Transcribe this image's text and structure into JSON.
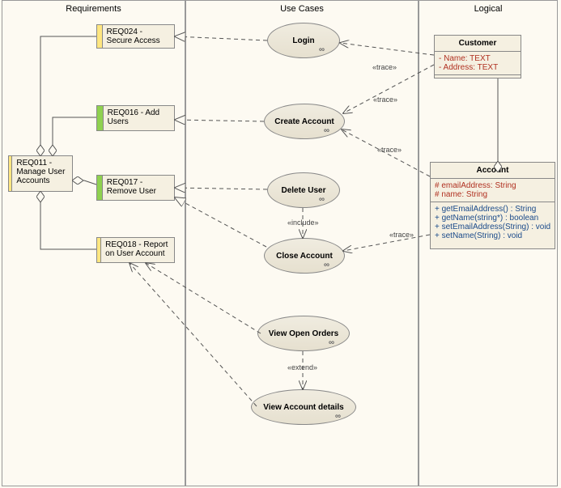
{
  "lanes": {
    "requirements": "Requirements",
    "usecases": "Use Cases",
    "logical": "Logical"
  },
  "requirements": {
    "req011": "REQ011 - Manage User Accounts",
    "req024": "REQ024 - Secure Access",
    "req016": "REQ016 - Add Users",
    "req017": "REQ017 - Remove User",
    "req018": "REQ018 - Report on User Account"
  },
  "usecases": {
    "login": "Login",
    "create": "Create Account",
    "delete": "Delete User",
    "close": "Close Account",
    "view_open": "View Open Orders",
    "view_details": "View Account details"
  },
  "classes": {
    "customer": {
      "name": "Customer",
      "attrs": [
        "-   Name:  TEXT",
        "-   Address:  TEXT"
      ]
    },
    "account": {
      "name": "Account",
      "attrs": [
        "#   emailAddress:  String",
        "#   name:  String"
      ],
      "ops": [
        "+   getEmailAddress() : String",
        "+   getName(string*) : boolean",
        "+   setEmailAddress(String) : void",
        "+   setName(String) : void"
      ]
    }
  },
  "labels": {
    "trace": "«trace»",
    "include": "«include»",
    "extend": "«extend»"
  }
}
